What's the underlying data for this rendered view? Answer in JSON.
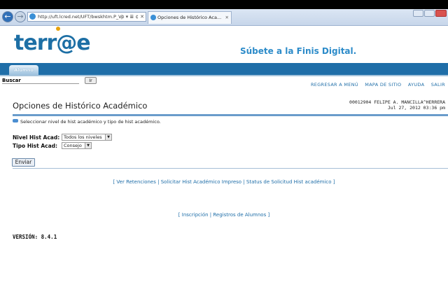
{
  "browser": {
    "address": "http://uft.lcred.net/UFT/bwskhtm.P_Vi",
    "address_controls": "ρ ▾ ≣ ¢ ✕",
    "tab_title": "Opciones de Histórico Aca...",
    "tab_close": "✕"
  },
  "brand": {
    "logo": "terr@e",
    "slogan": "Súbete a la Finis Digital."
  },
  "nav": {
    "tab_label": "Alumno"
  },
  "search": {
    "label": "Buscar",
    "placeholder": "",
    "button_label": "Ir"
  },
  "top_links": [
    {
      "label": "REGRESAR A MENÚ"
    },
    {
      "label": "MAPA DE SITIO"
    },
    {
      "label": "AYUDA"
    },
    {
      "label": "SALIR"
    }
  ],
  "page": {
    "title": "Opciones de Histórico Académico",
    "user": "00012904 FELIPE A. MANCILLA^HERRERA",
    "datetime": "Jul 27, 2012 03:36 pm",
    "info_text": "Seleccionar nivel de hist académico y tipo de hist académico."
  },
  "form": {
    "nivel_label": "Nivel Hist Acad:",
    "nivel_value": "Todos los niveles",
    "tipo_label": "Tipo Hist Acad:",
    "tipo_value": "Consejo",
    "submit_label": "Enviar"
  },
  "links_row1": {
    "open": "[",
    "ver_retenciones": "Ver Retenciones",
    "solicitar": "Solicitar Hist Académico Impreso",
    "status": "Status de Solicitud Hist académico",
    "close": "]",
    "sep": "|"
  },
  "links_row2": {
    "open": "[",
    "inscripcion": "Inscripción",
    "registros": "Registros de Alumnos",
    "close": "]",
    "sep": "|"
  },
  "footer": {
    "version": "VERSIÓN: 8.4.1"
  },
  "colors": {
    "brand_blue": "#1f6ea8",
    "logo_blue": "#1d6fa5",
    "accent_orange": "#e8a20b",
    "link_blue": "#1f6ea8"
  }
}
